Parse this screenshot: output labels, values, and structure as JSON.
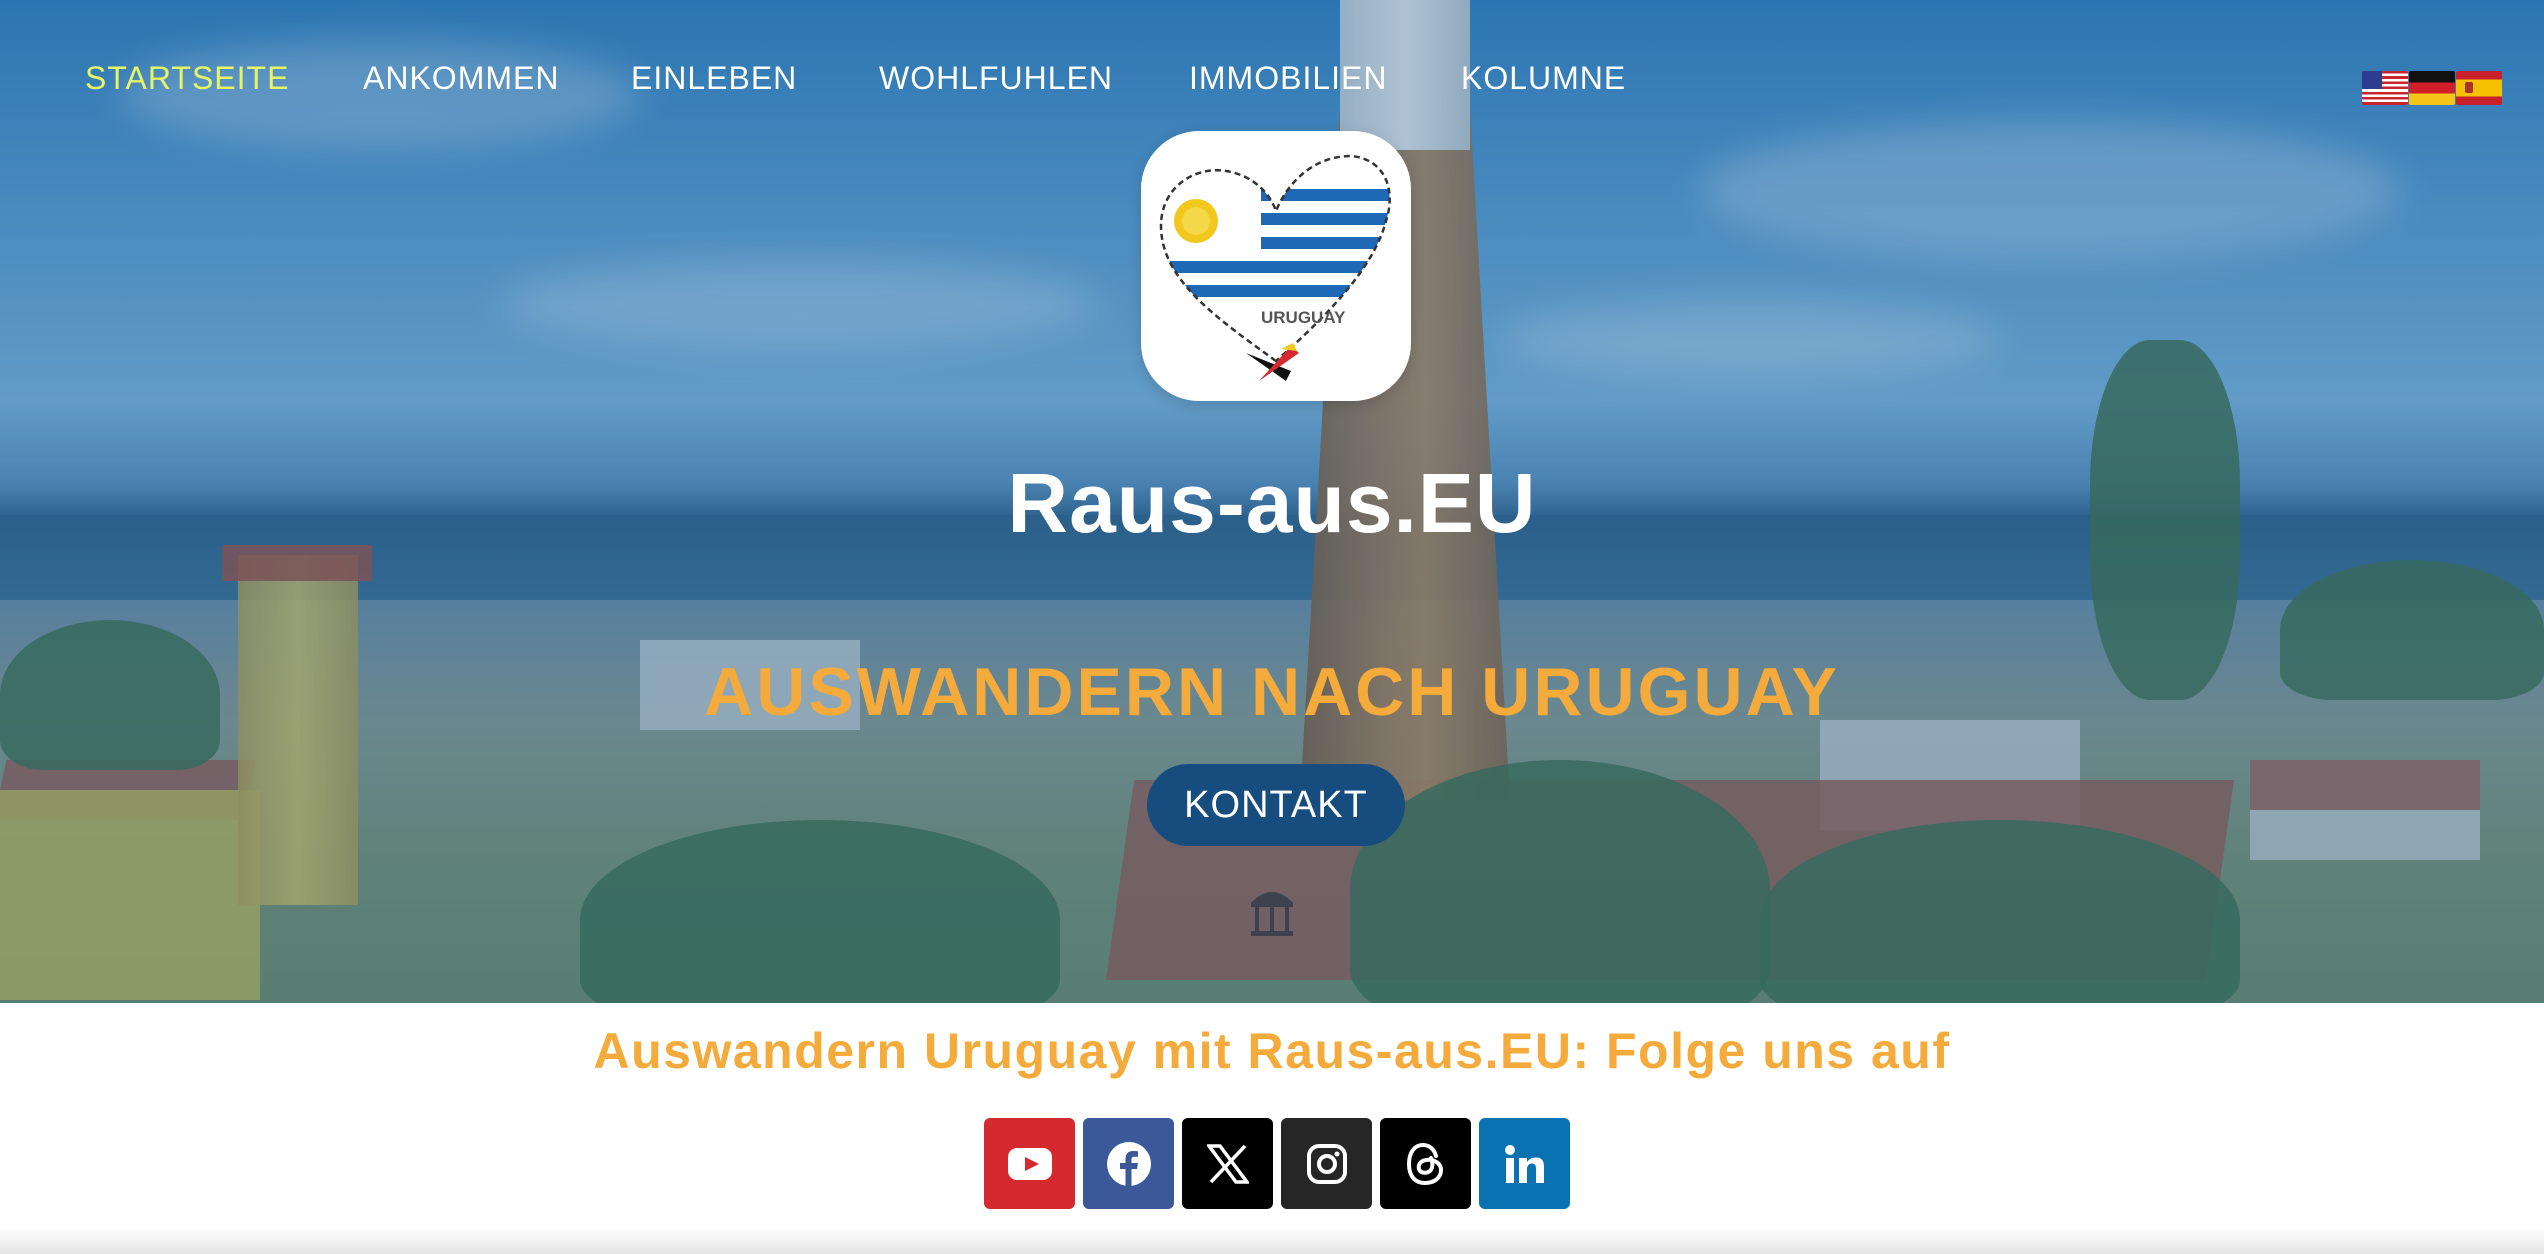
{
  "nav": {
    "items": [
      {
        "label": "STARTSEITE",
        "active": true
      },
      {
        "label": "ANKOMMEN",
        "active": false
      },
      {
        "label": "EINLEBEN",
        "active": false
      },
      {
        "label": "WOHLFUHLEN",
        "active": false
      },
      {
        "label": "IMMOBILIEN",
        "active": false
      },
      {
        "label": "KOLUMNE",
        "active": false
      }
    ]
  },
  "languages": [
    {
      "icon": "us-flag-icon"
    },
    {
      "icon": "de-flag-icon"
    },
    {
      "icon": "es-flag-icon"
    }
  ],
  "logo": {
    "text": "URUGUAY",
    "icon": "uruguay-heart-logo"
  },
  "hero": {
    "title": "Raus-aus.EU",
    "tagline": "AUSWANDERN NACH URUGUAY",
    "cta_label": "KONTAKT"
  },
  "follow": {
    "heading": "Auswandern Uruguay mit Raus-aus.EU: Folge uns auf",
    "socials": [
      {
        "icon": "youtube-icon",
        "color": "#d42a2f"
      },
      {
        "icon": "facebook-icon",
        "color": "#3b5998"
      },
      {
        "icon": "x-icon",
        "color": "#000000"
      },
      {
        "icon": "instagram-icon",
        "color": "#262626"
      },
      {
        "icon": "threads-icon",
        "color": "#000000"
      },
      {
        "icon": "linkedin-icon",
        "color": "#0a72b1"
      }
    ]
  },
  "colors": {
    "accent_orange": "#f4ab3b",
    "active_nav": "#e6f564",
    "button_blue": "#174c7e"
  }
}
